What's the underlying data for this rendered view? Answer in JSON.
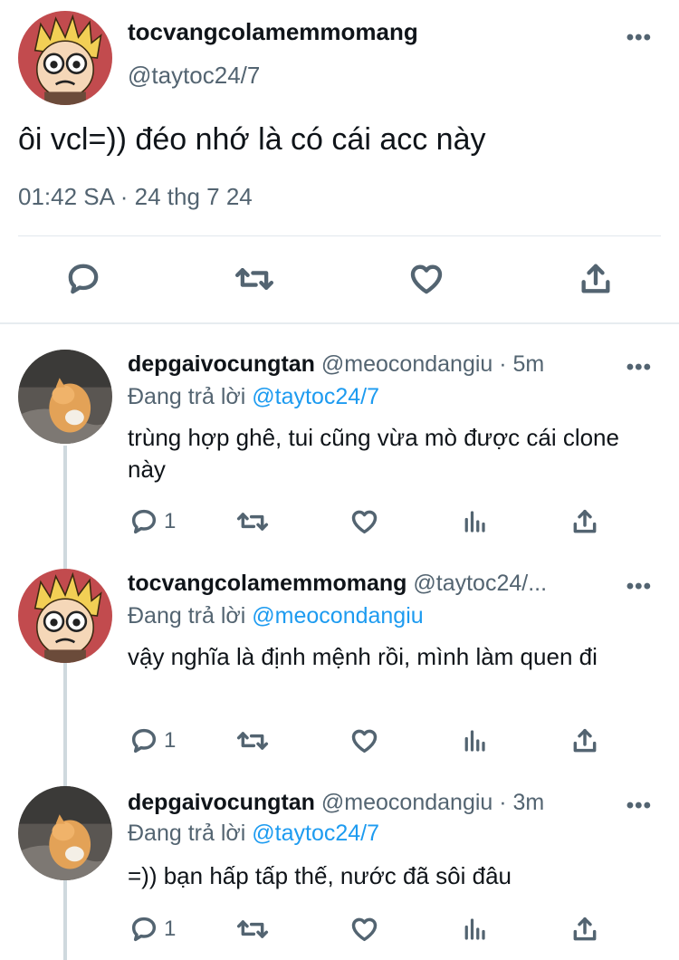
{
  "main_tweet": {
    "display_name": "tocvangcolamemmomang",
    "handle": "@taytoc24/7",
    "more": "•••",
    "text": "ôi vcl=)) đéo nhớ là có cái acc này",
    "meta": "01:42 SA · 24 thg 7 24",
    "actions": [
      "reply-icon",
      "retweet-icon",
      "like-icon",
      "share-icon"
    ]
  },
  "replies": [
    {
      "display_name": "depgaivocungtan",
      "handle": " @meocondangiu · 5m",
      "more": "•••",
      "replying_prefix": "Đang trả lời ",
      "replying_to": "@taytoc24/7",
      "text": "trùng hợp ghê, tui cũng vừa mò được cái clone này",
      "reply_count": "1"
    },
    {
      "display_name": "tocvangcolamemmomang",
      "handle": " @taytoc24/...",
      "more": "•••",
      "replying_prefix": "Đang trả lời ",
      "replying_to": "@meocondangiu",
      "text": "vậy nghĩa là định mệnh rồi, mình làm quen đi",
      "reply_count": "1"
    },
    {
      "display_name": "depgaivocungtan",
      "handle": " @meocondangiu · 3m",
      "more": "•••",
      "replying_prefix": "Đang trả lời ",
      "replying_to": "@taytoc24/7",
      "text": "=)) bạn hấp tấp thế, nước đã sôi đâu",
      "reply_count": "1"
    }
  ],
  "colors": {
    "accent": "#1d9bf0",
    "secondary_text": "#536471",
    "primary_text": "#0f1419",
    "separator": "#e1e8ed"
  }
}
